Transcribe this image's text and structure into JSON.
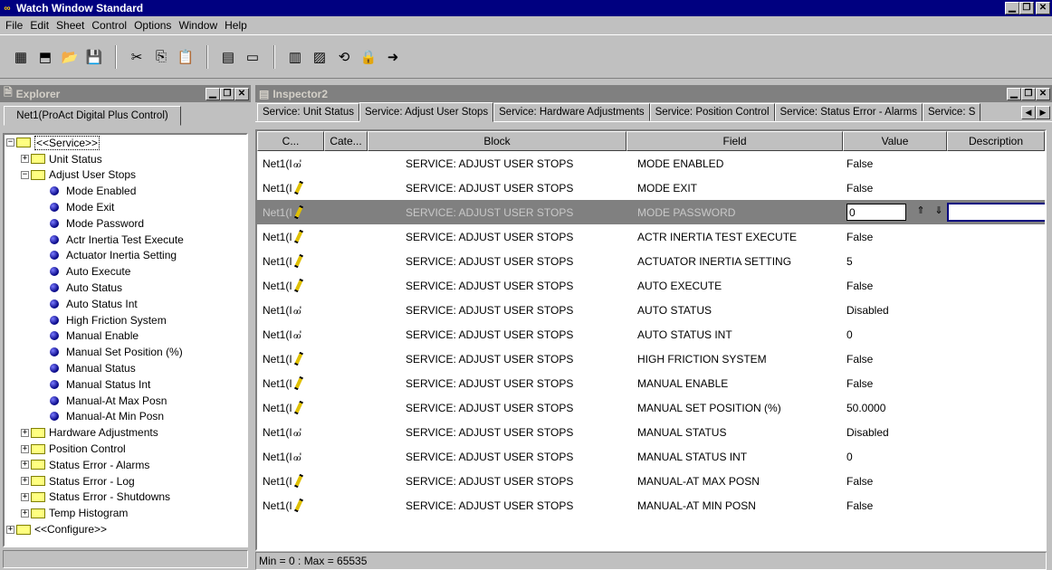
{
  "window": {
    "title": "Watch Window Standard",
    "app_icon": "∞",
    "minimize": "▁",
    "restore": "❐",
    "close": "✕"
  },
  "menu": [
    {
      "label": "File"
    },
    {
      "label": "Edit"
    },
    {
      "label": "Sheet"
    },
    {
      "label": "Control"
    },
    {
      "label": "Options"
    },
    {
      "label": "Window"
    },
    {
      "label": "Help"
    }
  ],
  "toolbar": {
    "buttons": [
      "new-sheet-icon",
      "new-control-icon",
      "open-folder-icon",
      "save-icon",
      "cut-icon",
      "copy-icon",
      "paste-icon",
      "add-inspector-icon",
      "inspector-icon",
      "properties-icon",
      "database-icon",
      "connect-icon",
      "lock-icon",
      "arrow-icon"
    ],
    "glyphs": [
      "▦",
      "⬒",
      "📂",
      "💾",
      "✂",
      "⎘",
      "📋",
      "▤",
      "▭",
      "▥",
      "▨",
      "⟲",
      "🔒",
      "➜"
    ]
  },
  "explorer": {
    "title": "Explorer",
    "tab_label": "Net1(ProAct Digital Plus Control)",
    "tree": [
      {
        "label": "<<Service>>",
        "level": 0,
        "type": "folder",
        "expander": "−"
      },
      {
        "label": "Unit Status",
        "level": 1,
        "type": "folder",
        "expander": "+"
      },
      {
        "label": "Adjust User Stops",
        "level": 1,
        "type": "folder",
        "expander": "−"
      },
      {
        "label": "Mode Enabled",
        "level": 2,
        "type": "item"
      },
      {
        "label": "Mode Exit",
        "level": 2,
        "type": "item"
      },
      {
        "label": "Mode Password",
        "level": 2,
        "type": "item"
      },
      {
        "label": "Actr Inertia Test Execute",
        "level": 2,
        "type": "item"
      },
      {
        "label": "Actuator Inertia Setting",
        "level": 2,
        "type": "item"
      },
      {
        "label": "Auto Execute",
        "level": 2,
        "type": "item"
      },
      {
        "label": "Auto Status",
        "level": 2,
        "type": "item"
      },
      {
        "label": "Auto Status Int",
        "level": 2,
        "type": "item"
      },
      {
        "label": "High Friction System",
        "level": 2,
        "type": "item"
      },
      {
        "label": "Manual Enable",
        "level": 2,
        "type": "item"
      },
      {
        "label": "Manual Set Position (%)",
        "level": 2,
        "type": "item"
      },
      {
        "label": "Manual Status",
        "level": 2,
        "type": "item"
      },
      {
        "label": "Manual Status Int",
        "level": 2,
        "type": "item"
      },
      {
        "label": "Manual-At Max Posn",
        "level": 2,
        "type": "item"
      },
      {
        "label": "Manual-At Min Posn",
        "level": 2,
        "type": "item"
      },
      {
        "label": "Hardware Adjustments",
        "level": 1,
        "type": "folder",
        "expander": "+"
      },
      {
        "label": "Position Control",
        "level": 1,
        "type": "folder",
        "expander": "+"
      },
      {
        "label": "Status Error - Alarms",
        "level": 1,
        "type": "folder",
        "expander": "+"
      },
      {
        "label": "Status Error - Log",
        "level": 1,
        "type": "folder",
        "expander": "+"
      },
      {
        "label": "Status Error - Shutdowns",
        "level": 1,
        "type": "folder",
        "expander": "+"
      },
      {
        "label": "Temp Histogram",
        "level": 1,
        "type": "folder",
        "expander": "+"
      },
      {
        "label": "<<Configure>>",
        "level": 0,
        "type": "folder",
        "expander": "+"
      }
    ]
  },
  "inspector": {
    "title": "Inspector2",
    "tabs": [
      {
        "label": "Service: Unit Status"
      },
      {
        "label": "Service: Adjust User Stops",
        "active": true
      },
      {
        "label": "Service: Hardware Adjustments"
      },
      {
        "label": "Service: Position Control"
      },
      {
        "label": "Service: Status Error - Alarms"
      },
      {
        "label": "Service: S"
      }
    ],
    "tab_scroll": {
      "left": "◀",
      "right": "▶"
    },
    "columns": [
      "C...",
      "Cate...",
      "Block",
      "Field",
      "Value",
      "Description"
    ],
    "rows": [
      {
        "c": "Net1(I",
        "mode": "read",
        "block": "SERVICE: ADJUST USER STOPS",
        "field": "MODE ENABLED",
        "value": "False"
      },
      {
        "c": "Net1(I",
        "mode": "write",
        "block": "SERVICE: ADJUST USER STOPS",
        "field": "MODE EXIT",
        "value": "False"
      },
      {
        "c": "Net1(I",
        "mode": "write",
        "block": "SERVICE: ADJUST USER STOPS",
        "field": "MODE PASSWORD",
        "value": "0",
        "selected": true
      },
      {
        "c": "Net1(I",
        "mode": "write",
        "block": "SERVICE: ADJUST USER STOPS",
        "field": "ACTR INERTIA TEST EXECUTE",
        "value": "False"
      },
      {
        "c": "Net1(I",
        "mode": "write",
        "block": "SERVICE: ADJUST USER STOPS",
        "field": "ACTUATOR INERTIA SETTING",
        "value": "5"
      },
      {
        "c": "Net1(I",
        "mode": "write",
        "block": "SERVICE: ADJUST USER STOPS",
        "field": "AUTO EXECUTE",
        "value": "False"
      },
      {
        "c": "Net1(I",
        "mode": "read",
        "block": "SERVICE: ADJUST USER STOPS",
        "field": "AUTO STATUS",
        "value": "Disabled"
      },
      {
        "c": "Net1(I",
        "mode": "read",
        "block": "SERVICE: ADJUST USER STOPS",
        "field": "AUTO STATUS INT",
        "value": "0"
      },
      {
        "c": "Net1(I",
        "mode": "write",
        "block": "SERVICE: ADJUST USER STOPS",
        "field": "HIGH FRICTION SYSTEM",
        "value": "False"
      },
      {
        "c": "Net1(I",
        "mode": "write",
        "block": "SERVICE: ADJUST USER STOPS",
        "field": "MANUAL ENABLE",
        "value": "False"
      },
      {
        "c": "Net1(I",
        "mode": "write",
        "block": "SERVICE: ADJUST USER STOPS",
        "field": "MANUAL SET POSITION (%)",
        "value": "50.0000"
      },
      {
        "c": "Net1(I",
        "mode": "read",
        "block": "SERVICE: ADJUST USER STOPS",
        "field": "MANUAL STATUS",
        "value": "Disabled"
      },
      {
        "c": "Net1(I",
        "mode": "read",
        "block": "SERVICE: ADJUST USER STOPS",
        "field": "MANUAL STATUS INT",
        "value": "0"
      },
      {
        "c": "Net1(I",
        "mode": "write",
        "block": "SERVICE: ADJUST USER STOPS",
        "field": "MANUAL-AT MAX POSN",
        "value": "False"
      },
      {
        "c": "Net1(I",
        "mode": "write",
        "block": "SERVICE: ADJUST USER STOPS",
        "field": "MANUAL-AT MIN POSN",
        "value": "False"
      }
    ],
    "spin_up": "⇑",
    "spin_down": "⇓",
    "read_icon": "ℴℴ'",
    "status": "Min = 0 : Max = 65535"
  }
}
